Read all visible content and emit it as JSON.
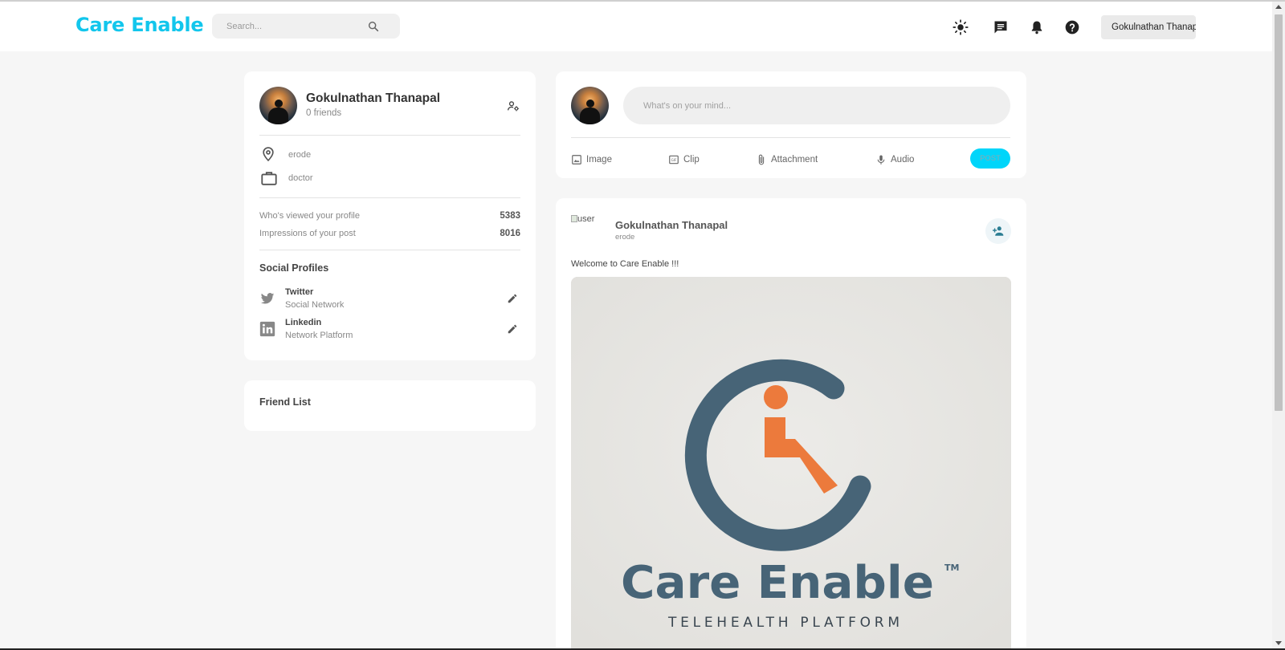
{
  "header": {
    "logo": "Care Enable",
    "search_placeholder": "Search...",
    "user_button": "Gokulnathan Thanapal"
  },
  "profile": {
    "name": "Gokulnathan Thanapal",
    "friends": "0 friends",
    "location": "erode",
    "occupation": "doctor",
    "stats": [
      {
        "label": "Who's viewed your profile",
        "value": "5383"
      },
      {
        "label": "Impressions of your post",
        "value": "8016"
      }
    ],
    "social_title": "Social Profiles",
    "social": [
      {
        "name": "Twitter",
        "sub": "Social Network"
      },
      {
        "name": "Linkedin",
        "sub": "Network Platform"
      }
    ]
  },
  "friend_list": {
    "title": "Friend List"
  },
  "composer": {
    "placeholder": "What's on your mind...",
    "actions": [
      "Image",
      "Clip",
      "Attachment",
      "Audio"
    ],
    "post_label": "POST"
  },
  "post": {
    "avatar_alt": "user",
    "author": "Gokulnathan Thanapal",
    "location": "erode",
    "text": "Welcome to Care Enable !!!",
    "image_brand": "Care Enable",
    "image_tm": "TM",
    "image_tagline": "TELEHEALTH PLATFORM"
  },
  "colors": {
    "accent": "#12c6ec",
    "post_button": "#00d5fa",
    "brand_slate": "#476477",
    "brand_orange": "#ec7a3c"
  }
}
